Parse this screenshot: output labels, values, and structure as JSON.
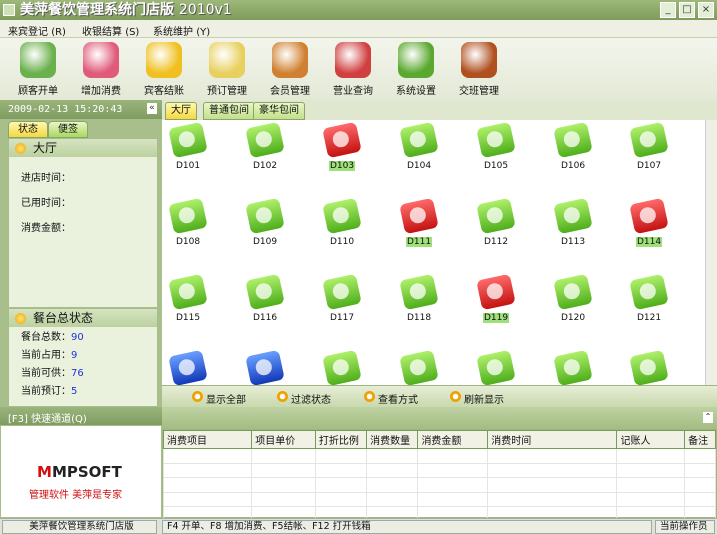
{
  "window": {
    "title": "美萍餐饮管理系统门店版",
    "version": "2010v1"
  },
  "menu": [
    {
      "label": "来宾登记",
      "key": "(R)"
    },
    {
      "label": "收银结算",
      "key": "(S)"
    },
    {
      "label": "系统维护",
      "key": "(Y)"
    }
  ],
  "toolbar": [
    {
      "label": "顾客开单",
      "icon": "tea-cup-icon",
      "color": "#6ab04c"
    },
    {
      "label": "增加消费",
      "icon": "add-icon",
      "color": "#e05a7a"
    },
    {
      "label": "宾客结账",
      "icon": "dollar-arrow-icon",
      "color": "#f0c020"
    },
    {
      "label": "预订管理",
      "icon": "clock-icon",
      "color": "#e8d060"
    },
    {
      "label": "会员管理",
      "icon": "members-icon",
      "color": "#d08030"
    },
    {
      "label": "营业查询",
      "icon": "search-report-icon",
      "color": "#d04040"
    },
    {
      "label": "系统设置",
      "icon": "gear-icon",
      "color": "#5aa830"
    },
    {
      "label": "交班管理",
      "icon": "exit-door-icon",
      "color": "#b05020"
    }
  ],
  "clock": "2009-02-13 15:20:43",
  "left_tabs": [
    "状态",
    "便签"
  ],
  "hall_section": {
    "title": "大厅",
    "fields": [
      "进店时间：",
      "已用时间：",
      "消费金额："
    ]
  },
  "summary_section": {
    "title": "餐台总状态",
    "fields": [
      {
        "label": "餐台总数：",
        "value": "90"
      },
      {
        "label": "当前占用：",
        "value": "9"
      },
      {
        "label": "当前可供：",
        "value": "76"
      },
      {
        "label": "当前预订：",
        "value": "5"
      }
    ]
  },
  "collapse_label": "«",
  "room_tabs": [
    "大厅",
    "普通包间",
    "豪华包间"
  ],
  "tables": [
    {
      "name": "D101",
      "status": "free"
    },
    {
      "name": "D102",
      "status": "free"
    },
    {
      "name": "D103",
      "status": "busy"
    },
    {
      "name": "D104",
      "status": "free"
    },
    {
      "name": "D105",
      "status": "free"
    },
    {
      "name": "D106",
      "status": "free"
    },
    {
      "name": "D107",
      "status": "free"
    },
    {
      "name": "D108",
      "status": "free"
    },
    {
      "name": "D109",
      "status": "free"
    },
    {
      "name": "D110",
      "status": "free"
    },
    {
      "name": "D111",
      "status": "busy"
    },
    {
      "name": "D112",
      "status": "free"
    },
    {
      "name": "D113",
      "status": "free"
    },
    {
      "name": "D114",
      "status": "busy"
    },
    {
      "name": "D115",
      "status": "free"
    },
    {
      "name": "D116",
      "status": "free"
    },
    {
      "name": "D117",
      "status": "free"
    },
    {
      "name": "D118",
      "status": "free"
    },
    {
      "name": "D119",
      "status": "busy"
    },
    {
      "name": "D120",
      "status": "free"
    },
    {
      "name": "D121",
      "status": "free"
    },
    {
      "name": "",
      "status": "reserved"
    },
    {
      "name": "",
      "status": "reserved"
    },
    {
      "name": "",
      "status": "free"
    },
    {
      "name": "",
      "status": "free"
    },
    {
      "name": "",
      "status": "free"
    },
    {
      "name": "",
      "status": "free"
    },
    {
      "name": "",
      "status": "free"
    }
  ],
  "actions": [
    "显示全部",
    "过滤状态",
    "查看方式",
    "刷新显示"
  ],
  "quick_channel": "[F3] 快速通道(Q)",
  "logo": {
    "brand": "MPSOFT",
    "slogan": "管理软件  美萍是专家"
  },
  "detail_columns": [
    "消费项目",
    "项目单价",
    "打折比例",
    "消费数量",
    "消费金额",
    "消费时间",
    "记账人",
    "备注"
  ],
  "status_bar": {
    "app": "美萍餐饮管理系统门店版",
    "hint": "F4 开单、F8 增加消费、F5结帐、F12 打开钱箱",
    "operator": "当前操作员"
  }
}
